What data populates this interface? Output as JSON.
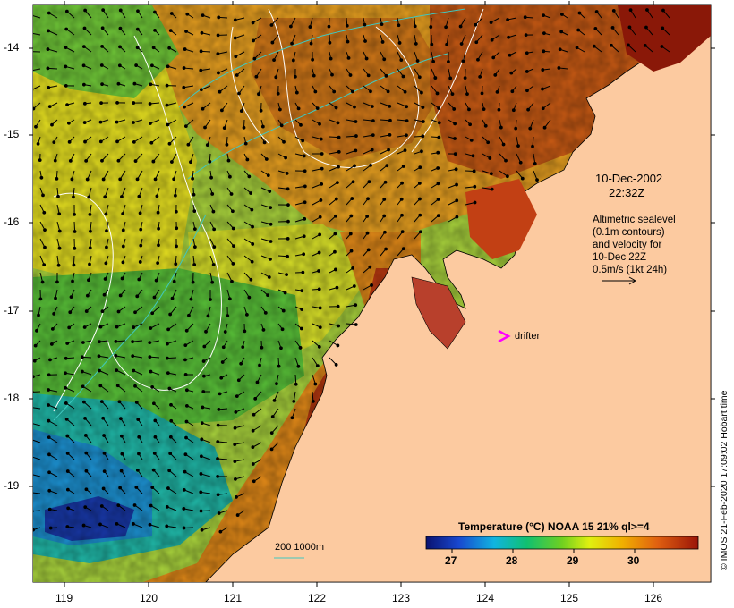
{
  "map": {
    "date": "10-Dec-2002",
    "time": "22:32Z",
    "info_lines": [
      "Altimetric sealevel",
      "(0.1m contours)",
      "and velocity for",
      "10-Dec 22Z",
      "0.5m/s (1kt 24h)"
    ],
    "drifter_label": "drifter",
    "credit": "© IMOS 21-Feb-2020 17:09:02 Hobart time",
    "depth_legend": "200  1000m",
    "colorbar": {
      "title": "Temperature (°C) NOAA 15 21% ql>=4",
      "ticks": [
        "27",
        "28",
        "29",
        "30"
      ]
    },
    "x_ticks": [
      "119",
      "120",
      "121",
      "122",
      "123",
      "124",
      "125",
      "126"
    ],
    "y_ticks": [
      "-14",
      "-15",
      "-16",
      "-17",
      "-18",
      "-19"
    ],
    "colors": {
      "land": "#fccaa0",
      "warm": "#b02810",
      "cold": "#102a9c",
      "vector_scale_arrow": "#000000",
      "drifter_marker": "#ff00ff",
      "depth_contour": "#40c8c0",
      "sealevel_contour": "#ffffff"
    }
  }
}
